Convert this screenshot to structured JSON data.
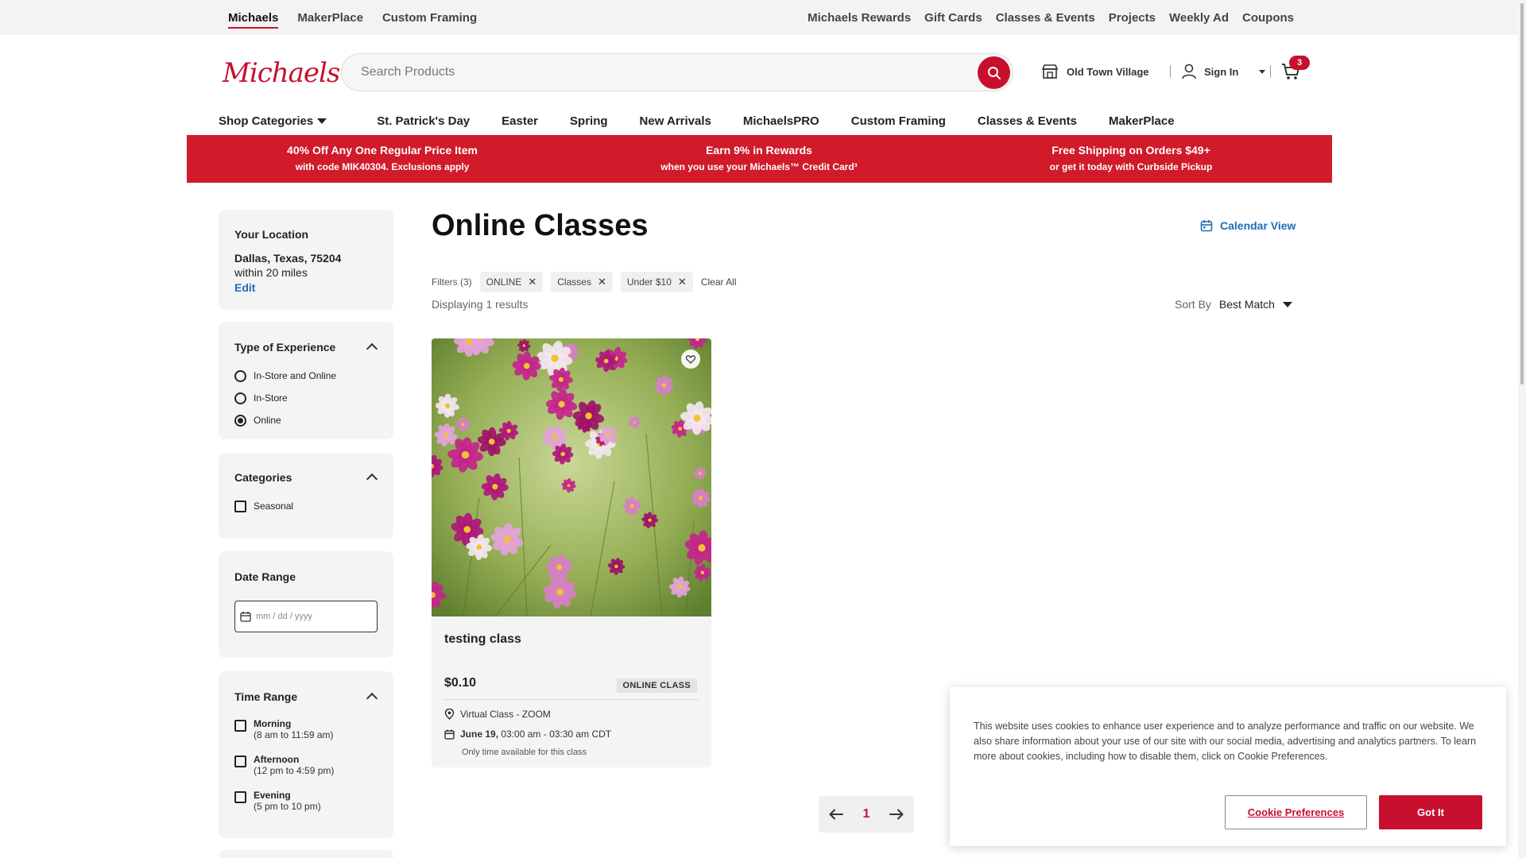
{
  "utility_bar": {
    "left_tabs": [
      "Michaels",
      "MakerPlace",
      "Custom Framing"
    ],
    "right_links": [
      "Michaels Rewards",
      "Gift Cards",
      "Classes & Events",
      "Projects",
      "Weekly Ad",
      "Coupons"
    ]
  },
  "header": {
    "logo": "Michaels",
    "search_placeholder": "Search Products",
    "store_name": "Old Town Village",
    "sign_in": "Sign In",
    "cart_count": "3"
  },
  "nav": {
    "shop_categories": "Shop Categories",
    "items": [
      "St. Patrick's Day",
      "Easter",
      "Spring",
      "New Arrivals",
      "MichaelsPRO",
      "Custom Framing",
      "Classes & Events",
      "MakerPlace"
    ]
  },
  "promo": [
    {
      "title": "40% Off Any One Regular Price Item",
      "subtitle": "with code MIK40304. Exclusions apply"
    },
    {
      "title": "Earn 9% in Rewards",
      "subtitle": "when you use your Michaels™ Credit Card³"
    },
    {
      "title": "Free Shipping on Orders $49+",
      "subtitle": "or get it today with Curbside Pickup"
    }
  ],
  "sidebar": {
    "location": {
      "heading": "Your Location",
      "city": "Dallas, Texas, 75204",
      "radius": "within 20 miles",
      "edit": "Edit"
    },
    "experience": {
      "heading": "Type of Experience",
      "options": [
        "In-Store and Online",
        "In-Store",
        "Online"
      ],
      "selected": "Online"
    },
    "categories": {
      "heading": "Categories",
      "options": [
        "Seasonal"
      ]
    },
    "date_range": {
      "heading": "Date Range",
      "placeholder": "mm / dd / yyyy"
    },
    "time_range": {
      "heading": "Time Range",
      "options": [
        {
          "label": "Morning",
          "sub": "(8 am to 11:59 am)"
        },
        {
          "label": "Afternoon",
          "sub": "(12 pm to 4:59 pm)"
        },
        {
          "label": "Evening",
          "sub": "(5 pm to 10 pm)"
        }
      ]
    }
  },
  "main": {
    "title": "Online Classes",
    "calendar_view": "Calendar View",
    "filters_label": "Filters (3)",
    "filter_chips": [
      "ONLINE",
      "Classes",
      "Under $10"
    ],
    "clear_all": "Clear All",
    "results": "Displaying 1 results",
    "sort_label": "Sort By",
    "sort_value": "Best Match"
  },
  "product": {
    "name": "testing class",
    "price": "$0.10",
    "tag": "ONLINE CLASS",
    "location": "Virtual Class - ZOOM",
    "date": "June 19,",
    "time": "03:00 am - 03:30 am CDT",
    "note": "Only time available for this class"
  },
  "pagination": {
    "current": "1"
  },
  "cookie": {
    "text": "This website uses cookies to enhance user experience and to analyze performance and traffic on our website. We also share information about your use of our site with our social media, advertising and analytics partners. To learn more about cookies, including how to disable them, click on Cookie Preferences.",
    "preferences": "Cookie Preferences",
    "accept": "Got It"
  },
  "colors": {
    "brand_red": "#c8102e",
    "link_blue": "#1f6cb6",
    "panel_gray": "#f4f4f4"
  }
}
